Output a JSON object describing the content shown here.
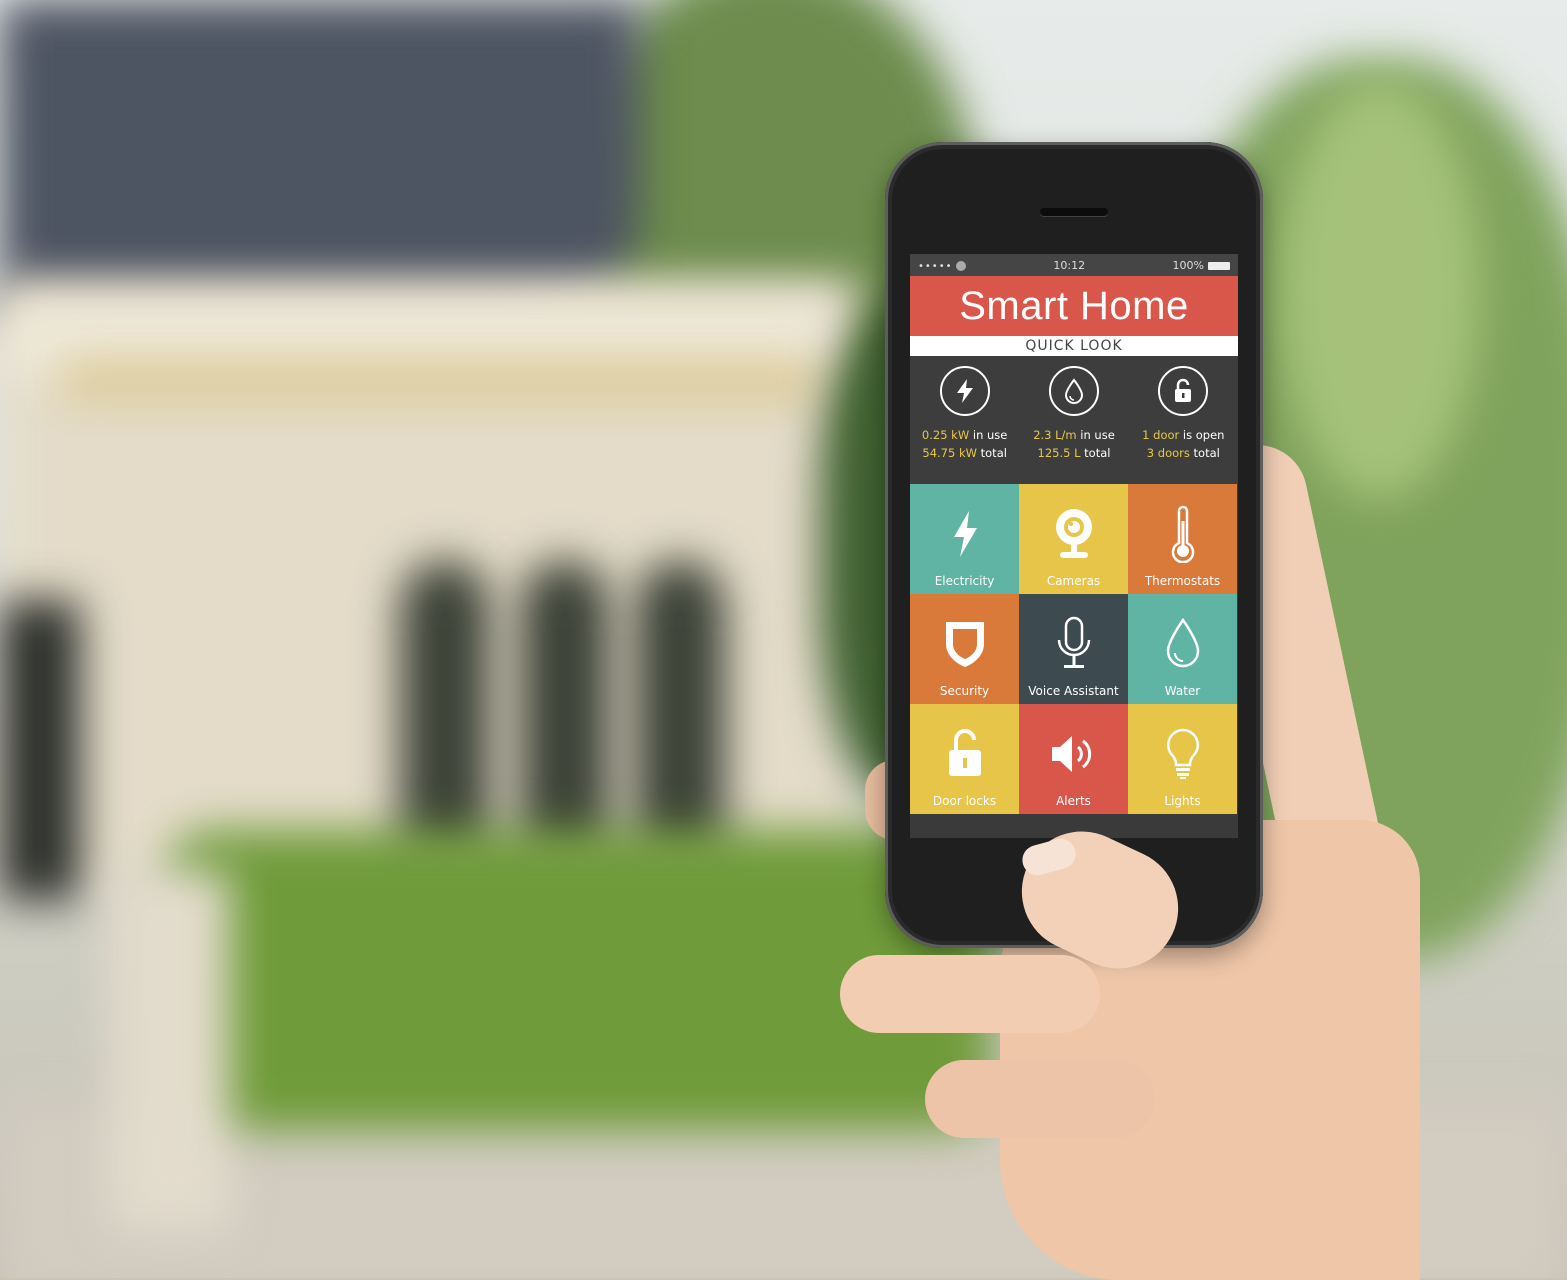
{
  "status_bar": {
    "signal": "•••••",
    "time": "10:12",
    "battery": "100%"
  },
  "app": {
    "title": "Smart Home",
    "subtitle": "QUICK LOOK"
  },
  "quick_look": [
    {
      "icon": "lightning-icon",
      "line1_value": "0.25 kW",
      "line1_text": " in use",
      "line2_value": "54.75 kW",
      "line2_text": " total"
    },
    {
      "icon": "water-drop-icon",
      "line1_value": "2.3 L/m",
      "line1_text": " in use",
      "line2_value": "125.5 L",
      "line2_text": " total"
    },
    {
      "icon": "unlock-icon",
      "line1_value": "1 door",
      "line1_text": " is open",
      "line2_value": "3 doors",
      "line2_text": " total"
    }
  ],
  "tiles": [
    {
      "label": "Electricity",
      "icon": "lightning-icon",
      "color": "#5fb4a4"
    },
    {
      "label": "Cameras",
      "icon": "webcam-icon",
      "color": "#e6c548"
    },
    {
      "label": "Thermostats",
      "icon": "thermometer-icon",
      "color": "#d9793a"
    },
    {
      "label": "Security",
      "icon": "shield-icon",
      "color": "#d9793a"
    },
    {
      "label": "Voice Assistant",
      "icon": "microphone-icon",
      "color": "#3d4a4f"
    },
    {
      "label": "Water",
      "icon": "water-drop-icon",
      "color": "#5fb4a4"
    },
    {
      "label": "Door locks",
      "icon": "unlock-icon",
      "color": "#e6c548"
    },
    {
      "label": "Alerts",
      "icon": "speaker-icon",
      "color": "#d9574a"
    },
    {
      "label": "Lights",
      "icon": "lightbulb-icon",
      "color": "#e6c548"
    }
  ],
  "colors": {
    "header": "#d9574a",
    "highlight": "#e7c84a",
    "panel": "#3d3d3d"
  }
}
